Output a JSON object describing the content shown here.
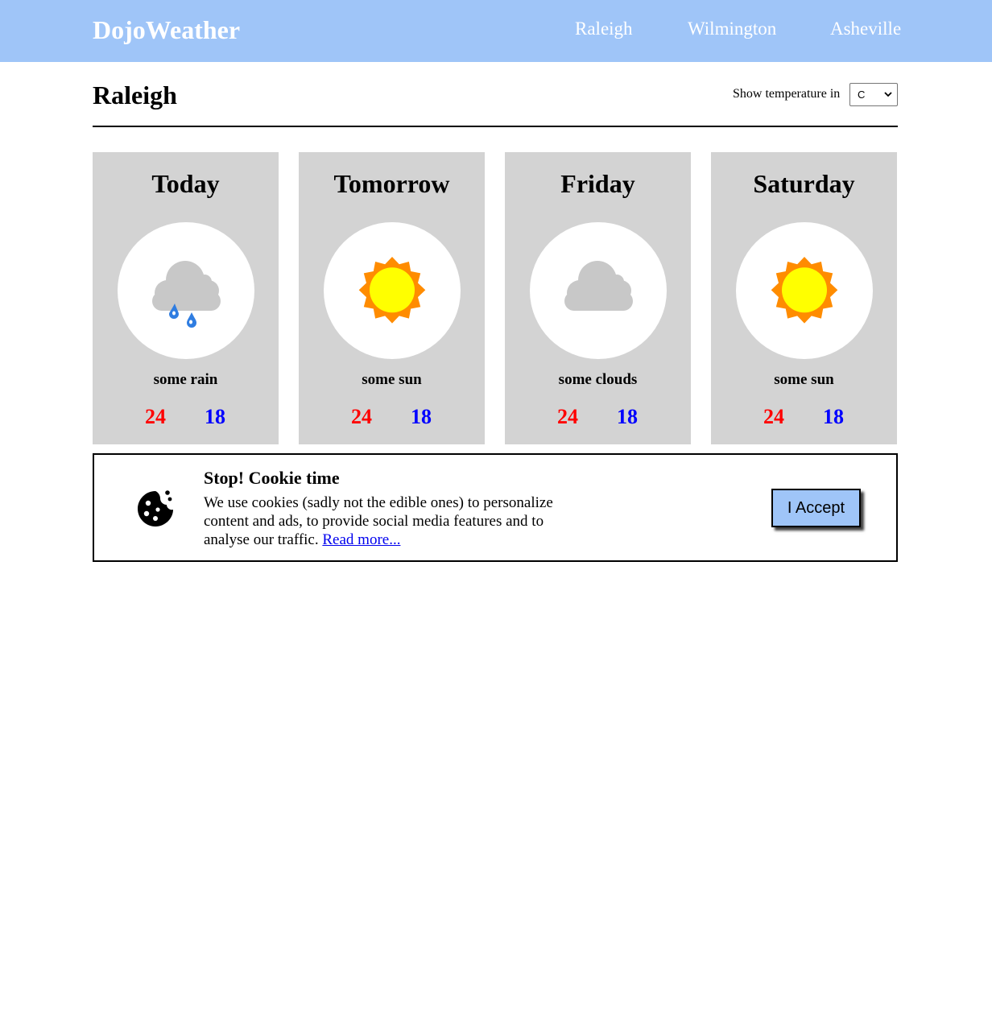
{
  "header": {
    "logo": "DojoWeather",
    "nav": [
      "Raleigh",
      "Wilmington",
      "Asheville"
    ]
  },
  "city": {
    "title": "Raleigh",
    "unit_label": "Show temperature in",
    "unit_selected": "C"
  },
  "forecast": [
    {
      "day": "Today",
      "icon": "rain-cloud-icon",
      "description": "some rain",
      "high": "24",
      "low": "18"
    },
    {
      "day": "Tomorrow",
      "icon": "sun-icon",
      "description": "some sun",
      "high": "24",
      "low": "18"
    },
    {
      "day": "Friday",
      "icon": "cloud-icon",
      "description": "some clouds",
      "high": "24",
      "low": "18"
    },
    {
      "day": "Saturday",
      "icon": "sun-icon",
      "description": "some sun",
      "high": "24",
      "low": "18"
    }
  ],
  "cookie": {
    "icon": "cookie-icon",
    "title": "Stop! Cookie time",
    "text": "We use cookies (sadly not the edible ones) to personalize content and ads, to provide social media features and to analyse our traffic.",
    "link": "Read more...",
    "accept": "I Accept"
  },
  "colors": {
    "header_bg": "#9fc5f8",
    "card_bg": "#d3d3d3",
    "high_temp": "#ff0000",
    "low_temp": "#0000ff",
    "sun_rays": "#ff8c00",
    "sun_core": "#ffff00",
    "cloud": "#c8c8c8",
    "rain_drop": "#2f7de1"
  }
}
